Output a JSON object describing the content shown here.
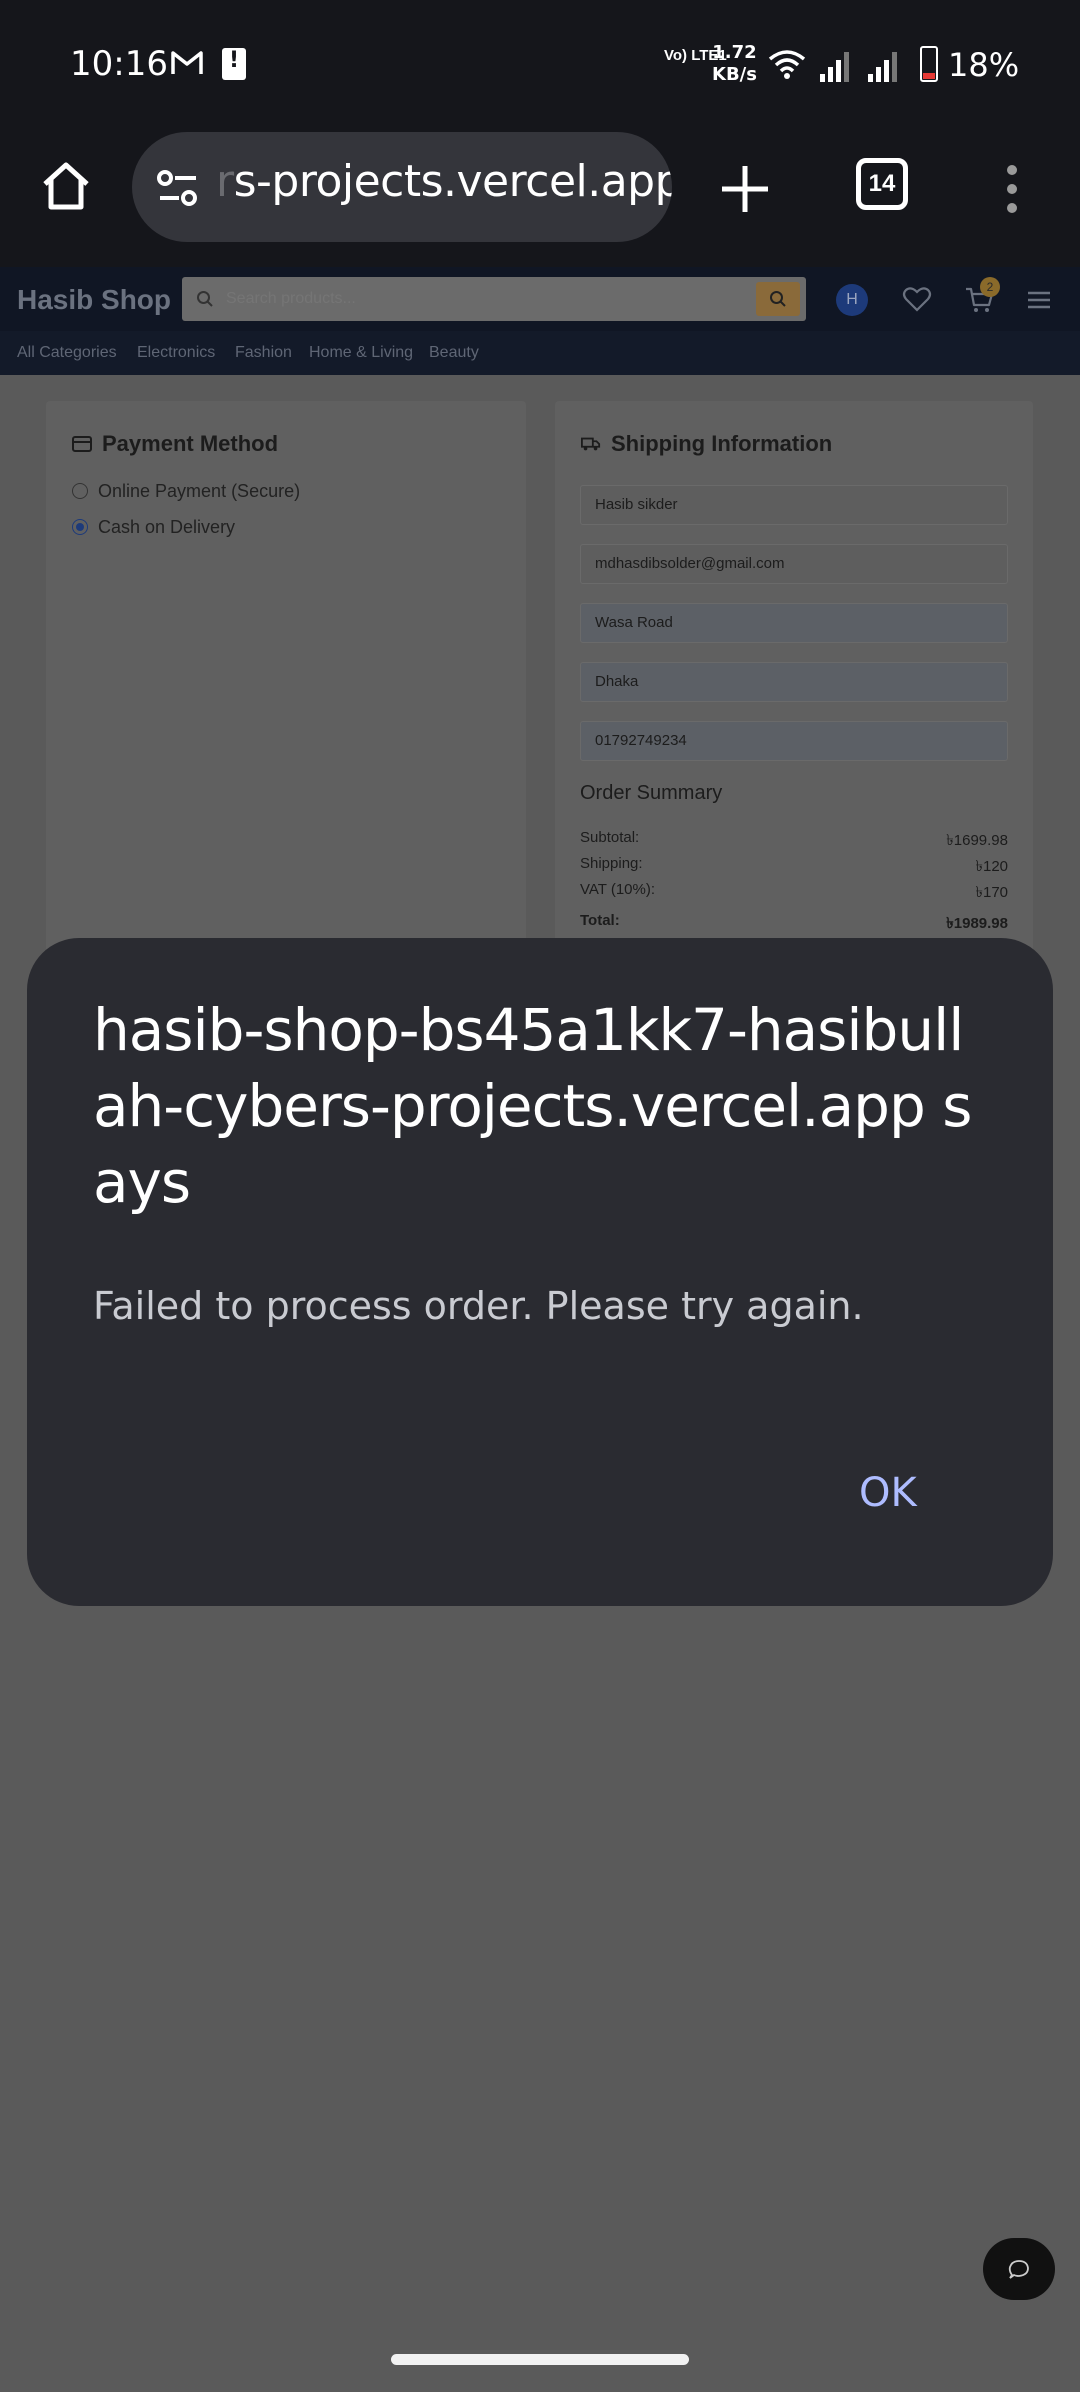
{
  "status_bar": {
    "time": "10:16",
    "network_type": "Vo) LTE1",
    "speed_value": "1.72",
    "speed_unit": "KB/s",
    "battery_percent": "18%",
    "battery_level": 0.18,
    "battery_color": "#e53935"
  },
  "browser": {
    "url_faded": "r",
    "url_visible": "s-projects.vercel.app",
    "tab_count": "14",
    "icons": [
      "home-icon",
      "site-settings-icon",
      "new-tab-icon",
      "tab-switcher-icon",
      "more-vert-icon"
    ]
  },
  "site": {
    "logo": "Hasib Shop",
    "search_placeholder": "Search products...",
    "avatar_initial": "H",
    "cart_count": "2",
    "accent_color": "#8a6a3a",
    "categories": [
      "All Categories",
      "Electronics",
      "Fashion",
      "Home & Living",
      "Beauty"
    ]
  },
  "payment": {
    "title": "Payment Method",
    "options": [
      {
        "label": "Online Payment (Secure)",
        "selected": false
      },
      {
        "label": "Cash on Delivery",
        "selected": true
      }
    ]
  },
  "shipping": {
    "title": "Shipping Information",
    "fields": [
      "Hasib sikder",
      "mdhasdibsolder@gmail.com",
      "Wasa Road",
      "Dhaka",
      "01792749234"
    ]
  },
  "order_summary": {
    "title": "Order Summary",
    "rows": [
      {
        "label": "Subtotal:",
        "value": "৳1699.98"
      },
      {
        "label": "Shipping:",
        "value": "৳120"
      },
      {
        "label": "VAT (10%):",
        "value": "৳170"
      },
      {
        "label": "Total:",
        "value": "৳1989.98"
      }
    ]
  },
  "dialog": {
    "title": "hasib-shop-bs45a1kk7-hasibullah-cybers-projects.vercel.app says",
    "message": "Failed to process order. Please try again.",
    "ok_label": "OK"
  }
}
